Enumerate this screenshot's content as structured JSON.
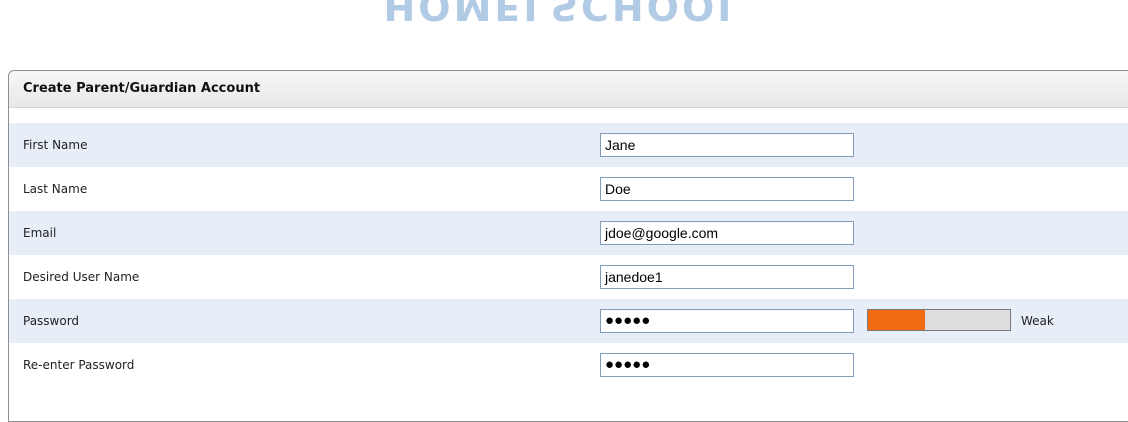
{
  "logo": {
    "text": "HOMELSCHOOL"
  },
  "form": {
    "title": "Create Parent/Guardian Account",
    "fields": [
      {
        "label": "First Name",
        "value": "Jane"
      },
      {
        "label": "Last Name",
        "value": "Doe"
      },
      {
        "label": "Email",
        "value": "jdoe@google.com"
      },
      {
        "label": "Desired User Name",
        "value": "janedoe1"
      },
      {
        "label": "Password",
        "value": "●●●●●"
      },
      {
        "label": "Re-enter Password",
        "value": "●●●●●"
      }
    ],
    "password_strength": {
      "level": 0.4,
      "label": "Weak",
      "color": "#f26a11"
    }
  },
  "colors": {
    "row_shade": "#e8eef8",
    "input_border": "#7f9db9"
  }
}
